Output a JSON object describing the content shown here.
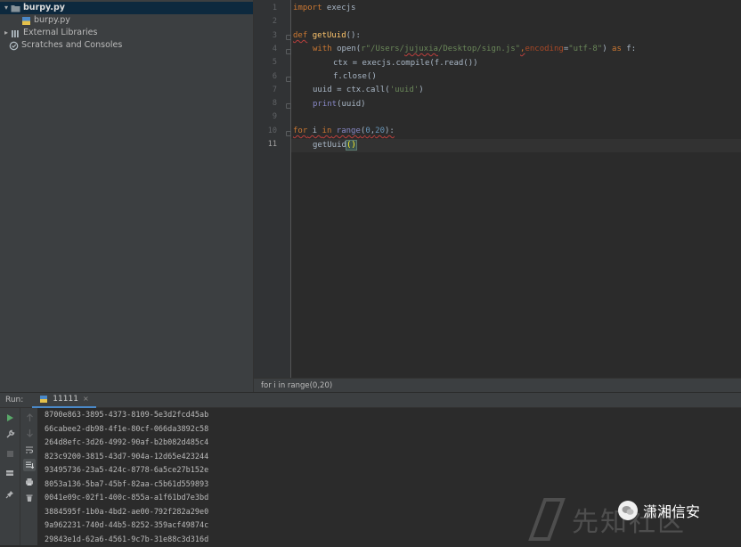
{
  "project_tree": {
    "items": [
      {
        "label": "burpy.py",
        "chevron": "▾",
        "bold": true,
        "selected": true,
        "icon": "folder-icon"
      },
      {
        "label": "burpy.py",
        "chevron": "",
        "bold": false,
        "selected": false,
        "icon": "python-file-icon"
      },
      {
        "label": "External Libraries",
        "chevron": "▸",
        "bold": false,
        "selected": false,
        "icon": "library-icon"
      },
      {
        "label": "Scratches and Consoles",
        "chevron": "",
        "bold": false,
        "selected": false,
        "icon": "scratches-icon"
      }
    ]
  },
  "editor": {
    "line_numbers": [
      "1",
      "2",
      "3",
      "4",
      "5",
      "6",
      "7",
      "8",
      "9",
      "10",
      "11"
    ],
    "current_line": "11",
    "code": {
      "l1_kw": "import",
      "l1_rest": " execjs",
      "l3_kw": "def",
      "l3_fn": "getUuid",
      "l3_rest": "():",
      "l4_kw": "with",
      "l4_open": " open(",
      "l4_str": "r\"/Users/",
      "l4_user": "jujuxia",
      "l4_str2": "/Desktop/sign.js\"",
      "l4_comma": ",",
      "l4_param": "encoding",
      "l4_eq": "=",
      "l4_str3": "\"utf-8\"",
      "l4_close": ") ",
      "l4_as": "as",
      "l4_f": " f:",
      "l5": "ctx = execjs.compile(f.read())",
      "l6": "f.close()",
      "l7_a": "uuid = ctx.call(",
      "l7_str": "'uuid'",
      "l7_b": ")",
      "l8_print": "print",
      "l8_rest": "(uuid)",
      "l10_for": "for",
      "l10_i": " i ",
      "l10_in": "in",
      "l10_range": " range",
      "l10_open": "(",
      "l10_n0": "0",
      "l10_comma": ",",
      "l10_n20": "20",
      "l10_close": "):",
      "l11_fn": "getUuid",
      "l11_paren": "()"
    },
    "breadcrumb": "for i in range(0,20)"
  },
  "run_panel": {
    "label": "Run:",
    "tab_label": "11111",
    "tab_close": "×",
    "output": [
      "8700e863-3895-4373-8109-5e3d2fcd45ab",
      "66cabee2-db98-4f1e-80cf-066da3892c58",
      "264d8efc-3d26-4992-90af-b2b082d485c4",
      "823c9200-3815-43d7-904a-12d65e423244",
      "93495736-23a5-424c-8778-6a5ce27b152e",
      "8053a136-5ba7-45bf-82aa-c5b61d559893",
      "0041e09c-02f1-400c-855a-a1f61bd7e3bd",
      "3884595f-1b0a-4bd2-ae00-792f282a29e0",
      "9a962231-740d-44b5-8252-359acf49874c",
      "29843e1d-62a6-4561-9c7b-31e88c3d316d"
    ]
  },
  "watermark": {
    "text": "先知社区",
    "badge": "潇湘信安"
  },
  "colors": {
    "keyword": "#cc7832",
    "function": "#ffc66d",
    "string": "#6a8759",
    "number": "#6897bb",
    "accent": "#4a88c7",
    "run_green": "#59a869"
  }
}
